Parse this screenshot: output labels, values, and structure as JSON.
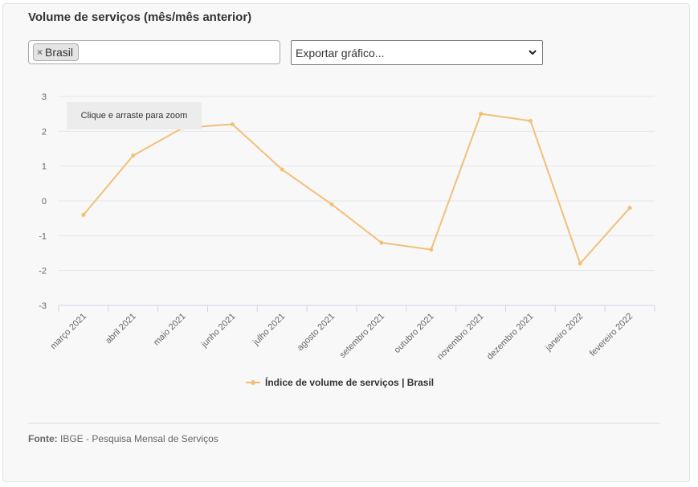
{
  "panel": {
    "title": "Volume de serviços (mês/mês anterior)"
  },
  "filter": {
    "tag_label": "Brasil",
    "remove_symbol": "×"
  },
  "export": {
    "selected_label": "Exportar gráfico...",
    "chevron_icon": "chevron-down-icon"
  },
  "zoom_hint": "Clique e arraste para zoom",
  "legend": {
    "label": "Índice de volume de serviços | Brasil"
  },
  "source": {
    "label": "Fonte:",
    "text": "IBGE - Pesquisa Mensal de Serviços"
  },
  "colors": {
    "series": "#f2bf78",
    "grid": "#e6e6e6",
    "axis": "#ccd6eb",
    "tick_text": "#666666"
  },
  "chart_data": {
    "type": "line",
    "categories": [
      "março 2021",
      "abril 2021",
      "maio 2021",
      "junho 2021",
      "julho 2021",
      "agosto 2021",
      "setembro 2021",
      "outubro 2021",
      "novembro 2021",
      "dezembro 2021",
      "janeiro 2022",
      "fevereiro 2022"
    ],
    "series": [
      {
        "name": "Índice de volume de serviços | Brasil",
        "values": [
          -0.4,
          1.3,
          2.1,
          2.2,
          0.9,
          -0.1,
          -1.2,
          -1.4,
          2.5,
          2.3,
          -1.8,
          -0.2
        ]
      }
    ],
    "ylim": [
      -3,
      3
    ],
    "yticks": [
      "3",
      "2",
      "1",
      "0",
      "-1",
      "-2",
      "-3"
    ],
    "ytick_values": [
      3,
      2,
      1,
      0,
      -1,
      -2,
      -3
    ],
    "grid": true,
    "legend_position": "bottom-center"
  }
}
